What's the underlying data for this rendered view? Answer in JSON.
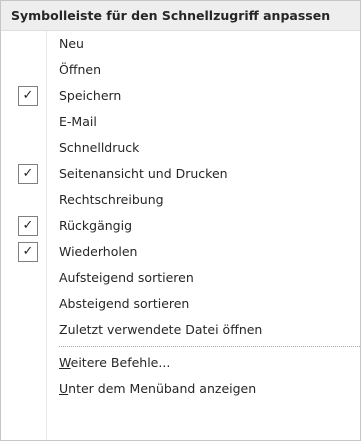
{
  "menu": {
    "title": "Symbolleiste für den Schnellzugriff anpassen",
    "check_glyph": "✓",
    "items": [
      {
        "label": "Neu",
        "checked": false
      },
      {
        "label": "Öffnen",
        "checked": false
      },
      {
        "label": "Speichern",
        "checked": true
      },
      {
        "label": "E-Mail",
        "checked": false
      },
      {
        "label": "Schnelldruck",
        "checked": false
      },
      {
        "label": "Seitenansicht und Drucken",
        "checked": true
      },
      {
        "label": "Rechtschreibung",
        "checked": false
      },
      {
        "label": "Rückgängig",
        "checked": true
      },
      {
        "label": "Wiederholen",
        "checked": true
      },
      {
        "label": "Aufsteigend sortieren",
        "checked": false
      },
      {
        "label": "Absteigend sortieren",
        "checked": false
      },
      {
        "label": "Zuletzt verwendete Datei öffnen",
        "checked": false
      }
    ],
    "more_commands": {
      "accel": "W",
      "rest": "eitere Befehle..."
    },
    "show_below": {
      "accel": "U",
      "rest": "nter dem Menüband anzeigen"
    }
  }
}
